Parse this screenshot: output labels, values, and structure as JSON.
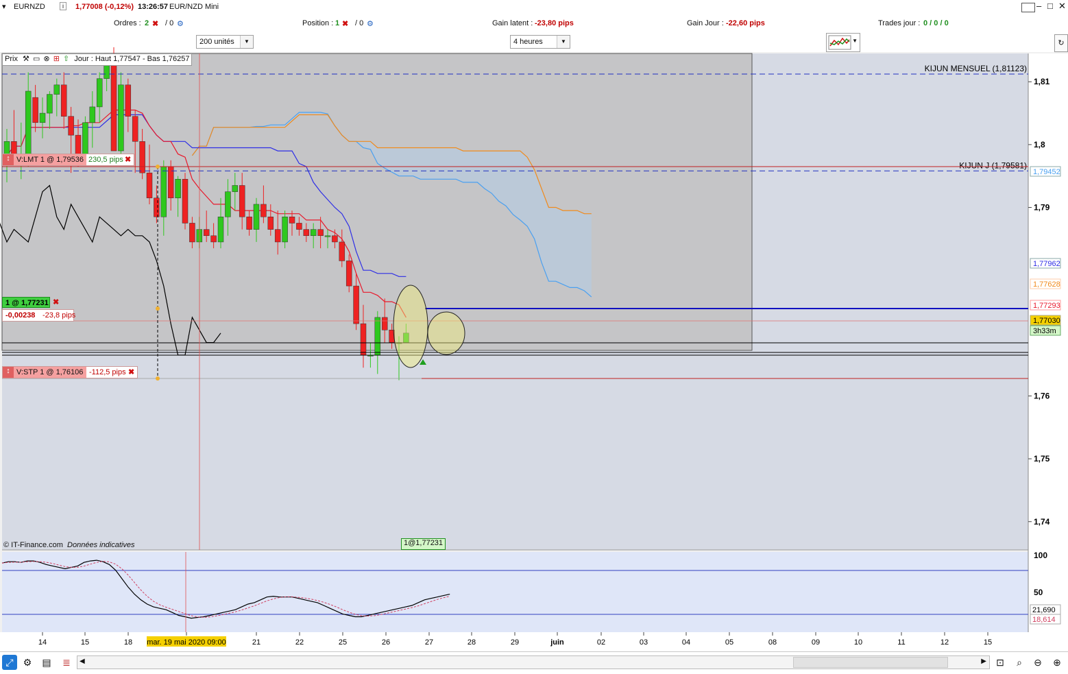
{
  "app": {
    "symbol": "EURNZD",
    "price_change": "1,77008 (-0,12%)",
    "time": "13:26:57",
    "window_title": "EUR/NZD Mini"
  },
  "status": {
    "orders_label": "Ordres :",
    "orders_count": "2",
    "orders_alt": "/ 0",
    "position_label": "Position :",
    "position_count": "1",
    "position_alt": "/ 0",
    "latent_label": "Gain latent :",
    "latent_value": "-23,80 pips",
    "day_label": "Gain Jour :",
    "day_value": "-22,60 pips",
    "trades_label": "Trades jour :",
    "trades_value": "0 / 0 / 0"
  },
  "toolbar": {
    "units": "200 unités",
    "timeframe": "4 heures"
  },
  "price_panel": {
    "title": "Prix",
    "range_info": "Jour : Haut 1,77547 - Bas 1,76257",
    "copyright": "© IT-Finance.com",
    "note": "Données indicatives",
    "entry_marker": "1@1,77231"
  },
  "orders": {
    "limit_label": "V:LMT  1 @ 1,79536",
    "limit_pips": "230,5 pips",
    "position_label": "1 @ 1,77231",
    "position_pnl": "-0,00238",
    "position_pips": "-23,8 pips",
    "stop_label": "V:STP  1 @ 1,76106",
    "stop_pips": "-112,5 pips"
  },
  "chart_data": {
    "type": "candlestick",
    "xlabel": "",
    "ylabel": "",
    "x_ticks": [
      "14",
      "15",
      "18",
      "mar. 19 mai 2020 09:00",
      "21",
      "22",
      "25",
      "26",
      "27",
      "28",
      "29",
      "juin",
      "02",
      "03",
      "04",
      "05",
      "08",
      "09",
      "10",
      "11",
      "12",
      "15"
    ],
    "y_ticks": [
      "1,81",
      "1,8",
      "1,79",
      "1,76",
      "1,75",
      "1,74"
    ],
    "ylim": [
      1.7355,
      1.8145
    ],
    "grid": false,
    "candles": [
      [
        1.798,
        1.8025,
        1.794,
        1.8005
      ],
      [
        1.8005,
        1.8055,
        1.7985,
        1.797
      ],
      [
        1.7975,
        1.8035,
        1.7945,
        1.7985
      ],
      [
        1.7985,
        1.8115,
        1.7965,
        1.8085
      ],
      [
        1.8075,
        1.8095,
        1.802,
        1.8035
      ],
      [
        1.8035,
        1.8075,
        1.801,
        1.805
      ],
      [
        1.805,
        1.8085,
        1.8025,
        1.808
      ],
      [
        1.808,
        1.8105,
        1.8045,
        1.8095
      ],
      [
        1.8095,
        1.8115,
        1.8025,
        1.8045
      ],
      [
        1.8045,
        1.806,
        1.7955,
        1.8015
      ],
      [
        1.8015,
        1.804,
        1.7965,
        1.7985
      ],
      [
        1.7985,
        1.8045,
        1.7975,
        1.8035
      ],
      [
        1.8035,
        1.8085,
        1.7995,
        1.806
      ],
      [
        1.806,
        1.8115,
        1.8035,
        1.8105
      ],
      [
        1.8105,
        1.8135,
        1.8085,
        1.8145
      ],
      [
        1.8145,
        1.8155,
        1.808,
        1.799
      ],
      [
        1.799,
        1.8115,
        1.7975,
        1.8095
      ],
      [
        1.8095,
        1.8105,
        1.802,
        1.8045
      ],
      [
        1.8045,
        1.8055,
        1.7955,
        1.8005
      ],
      [
        1.8005,
        1.8025,
        1.7945,
        1.7955
      ],
      [
        1.7955,
        1.8,
        1.7905,
        1.7915
      ],
      [
        1.7915,
        1.7935,
        1.7875,
        1.7885
      ],
      [
        1.7885,
        1.7975,
        1.7855,
        1.7965
      ],
      [
        1.7965,
        1.7975,
        1.7895,
        1.7915
      ],
      [
        1.7915,
        1.795,
        1.7885,
        1.7945
      ],
      [
        1.7945,
        1.7955,
        1.7865,
        1.7875
      ],
      [
        1.7875,
        1.7885,
        1.7835,
        1.7845
      ],
      [
        1.7845,
        1.7885,
        1.7835,
        1.7865
      ],
      [
        1.7865,
        1.7895,
        1.7845,
        1.7855
      ],
      [
        1.7855,
        1.7875,
        1.7835,
        1.7845
      ],
      [
        1.7845,
        1.7915,
        1.7835,
        1.7885
      ],
      [
        1.7885,
        1.7945,
        1.7855,
        1.7925
      ],
      [
        1.7925,
        1.7955,
        1.7895,
        1.7935
      ],
      [
        1.7935,
        1.7955,
        1.7865,
        1.7885
      ],
      [
        1.7885,
        1.7895,
        1.7855,
        1.7865
      ],
      [
        1.7865,
        1.7915,
        1.7845,
        1.7905
      ],
      [
        1.7905,
        1.7935,
        1.7875,
        1.7885
      ],
      [
        1.7885,
        1.7905,
        1.7855,
        1.7865
      ],
      [
        1.7865,
        1.7895,
        1.7825,
        1.7845
      ],
      [
        1.7845,
        1.7895,
        1.7835,
        1.7885
      ],
      [
        1.7885,
        1.7895,
        1.7855,
        1.7875
      ],
      [
        1.7875,
        1.7885,
        1.7855,
        1.7865
      ],
      [
        1.7865,
        1.7875,
        1.7845,
        1.7855
      ],
      [
        1.7855,
        1.7875,
        1.7835,
        1.7865
      ],
      [
        1.7865,
        1.7885,
        1.7835,
        1.7855
      ],
      [
        1.7855,
        1.7865,
        1.7835,
        1.7855
      ],
      [
        1.7855,
        1.7865,
        1.7835,
        1.7845
      ],
      [
        1.7845,
        1.7865,
        1.7805,
        1.7815
      ],
      [
        1.7815,
        1.7825,
        1.7765,
        1.7775
      ],
      [
        1.7775,
        1.7795,
        1.7705,
        1.7715
      ],
      [
        1.7715,
        1.7745,
        1.7645,
        1.7665
      ],
      [
        1.7665,
        1.7685,
        1.7645,
        1.7665
      ],
      [
        1.7665,
        1.7735,
        1.7635,
        1.7725
      ],
      [
        1.7725,
        1.7755,
        1.7685,
        1.7705
      ],
      [
        1.7705,
        1.7715,
        1.7675,
        1.7685
      ],
      [
        1.7685,
        1.7695,
        1.7625,
        1.7685
      ],
      [
        1.7685,
        1.7715,
        1.7685,
        1.77
      ]
    ],
    "levels": [
      {
        "name": "KIJUN MENSUEL (1,81123)",
        "value": 1.81123
      },
      {
        "name": "KIJUN J (1,79581)",
        "value": 1.79581
      }
    ],
    "price_labels": [
      "1,79452",
      "1,77962",
      "1,77628",
      "1,77293",
      "1,77030",
      "3h33m"
    ],
    "osc_ticks": [
      "100",
      "50"
    ],
    "osc_values": [
      "21,690",
      "18,614"
    ],
    "oscillator": [
      92,
      94,
      94,
      93,
      95,
      95,
      93,
      90,
      88,
      86,
      84,
      86,
      88,
      93,
      95,
      96,
      94,
      90,
      82,
      70,
      58,
      48,
      40,
      34,
      30,
      28,
      26,
      22,
      18,
      16,
      14,
      15,
      16,
      18,
      20,
      22,
      24,
      26,
      30,
      34,
      36,
      40,
      44,
      45,
      44,
      44,
      44,
      42,
      40,
      38,
      36,
      32,
      28,
      24,
      20,
      18,
      16,
      16,
      18,
      20,
      22,
      24,
      26,
      28,
      30,
      32,
      36,
      40,
      42,
      44,
      46,
      48
    ],
    "colors": {
      "tenkan": "#e8192c",
      "kijun": "#2e2ee6",
      "senkou_a": "#4aa0f0",
      "senkou_b": "#f08a1c",
      "chikou": "#000000",
      "cloud": "#b7cbe0",
      "up_candle": "#2ec81e",
      "down_candle": "#ee2222"
    }
  }
}
